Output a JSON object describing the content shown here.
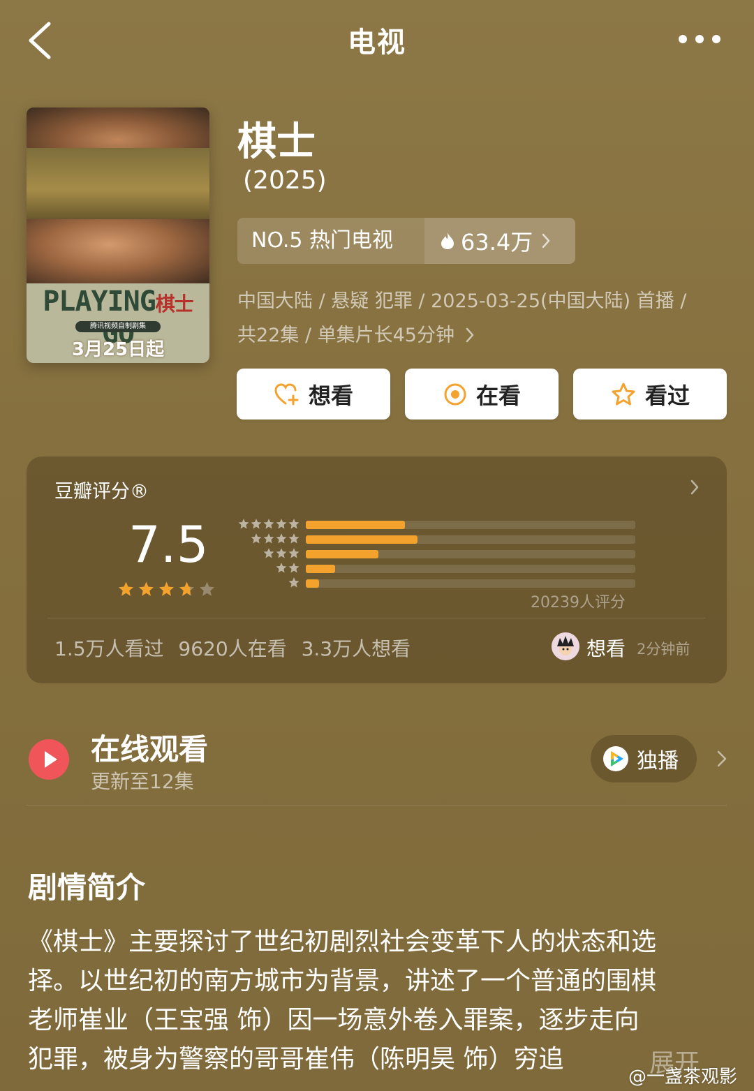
{
  "nav": {
    "title": "电视",
    "back_icon": "chevron-left-icon",
    "more_icon": "more-dots-icon"
  },
  "poster": {
    "wordmark_left": "PLAYING",
    "wordmark_mid": "棋士",
    "wordmark_right": "GO",
    "tagline": "腾讯视频自制剧集",
    "date": "3月25日起"
  },
  "show": {
    "title": "棋士",
    "year": "(2025)",
    "rank": "NO.5 热门电视",
    "heat": "63.4万",
    "meta_line1": "中国大陆 / 悬疑 犯罪 / 2025-03-25(中国大陆) 首播 /",
    "meta_line2": "共22集 / 单集片长45分钟"
  },
  "actions": {
    "want": "想看",
    "watching": "在看",
    "watched": "看过"
  },
  "rating": {
    "label": "豆瓣评分®",
    "score": "7.5",
    "stars": 3.75,
    "distribution": [
      {
        "stars": 5,
        "fraction": 0.3
      },
      {
        "stars": 4,
        "fraction": 0.34
      },
      {
        "stars": 3,
        "fraction": 0.22
      },
      {
        "stars": 2,
        "fraction": 0.09
      },
      {
        "stars": 1,
        "fraction": 0.04
      }
    ],
    "count": "20239人评分",
    "stats": "1.5万人看过   9620人在看   3.3万人想看",
    "recent_status": "想看",
    "recent_time": "2分钟前"
  },
  "online": {
    "title": "在线观看",
    "subtitle": "更新至12集",
    "platform": "独播"
  },
  "synopsis": {
    "title": "剧情简介",
    "lines": [
      "《棋士》主要探讨了世纪初剧烈社会变革下人的状态和选",
      "择。以世纪初的南方城市为背景，讲述了一个普通的围棋",
      "老师崔业（王宝强 饰）因一场意外卷入罪案，逐步走向",
      "犯罪，被身为警察的哥哥崔伟（陈明昊 饰）穷追"
    ],
    "expand": "展开"
  },
  "watermark": "@一盏茶观影",
  "colors": {
    "accent": "#f2a22d",
    "background": "#86703f",
    "play_red": "#f0555a"
  }
}
